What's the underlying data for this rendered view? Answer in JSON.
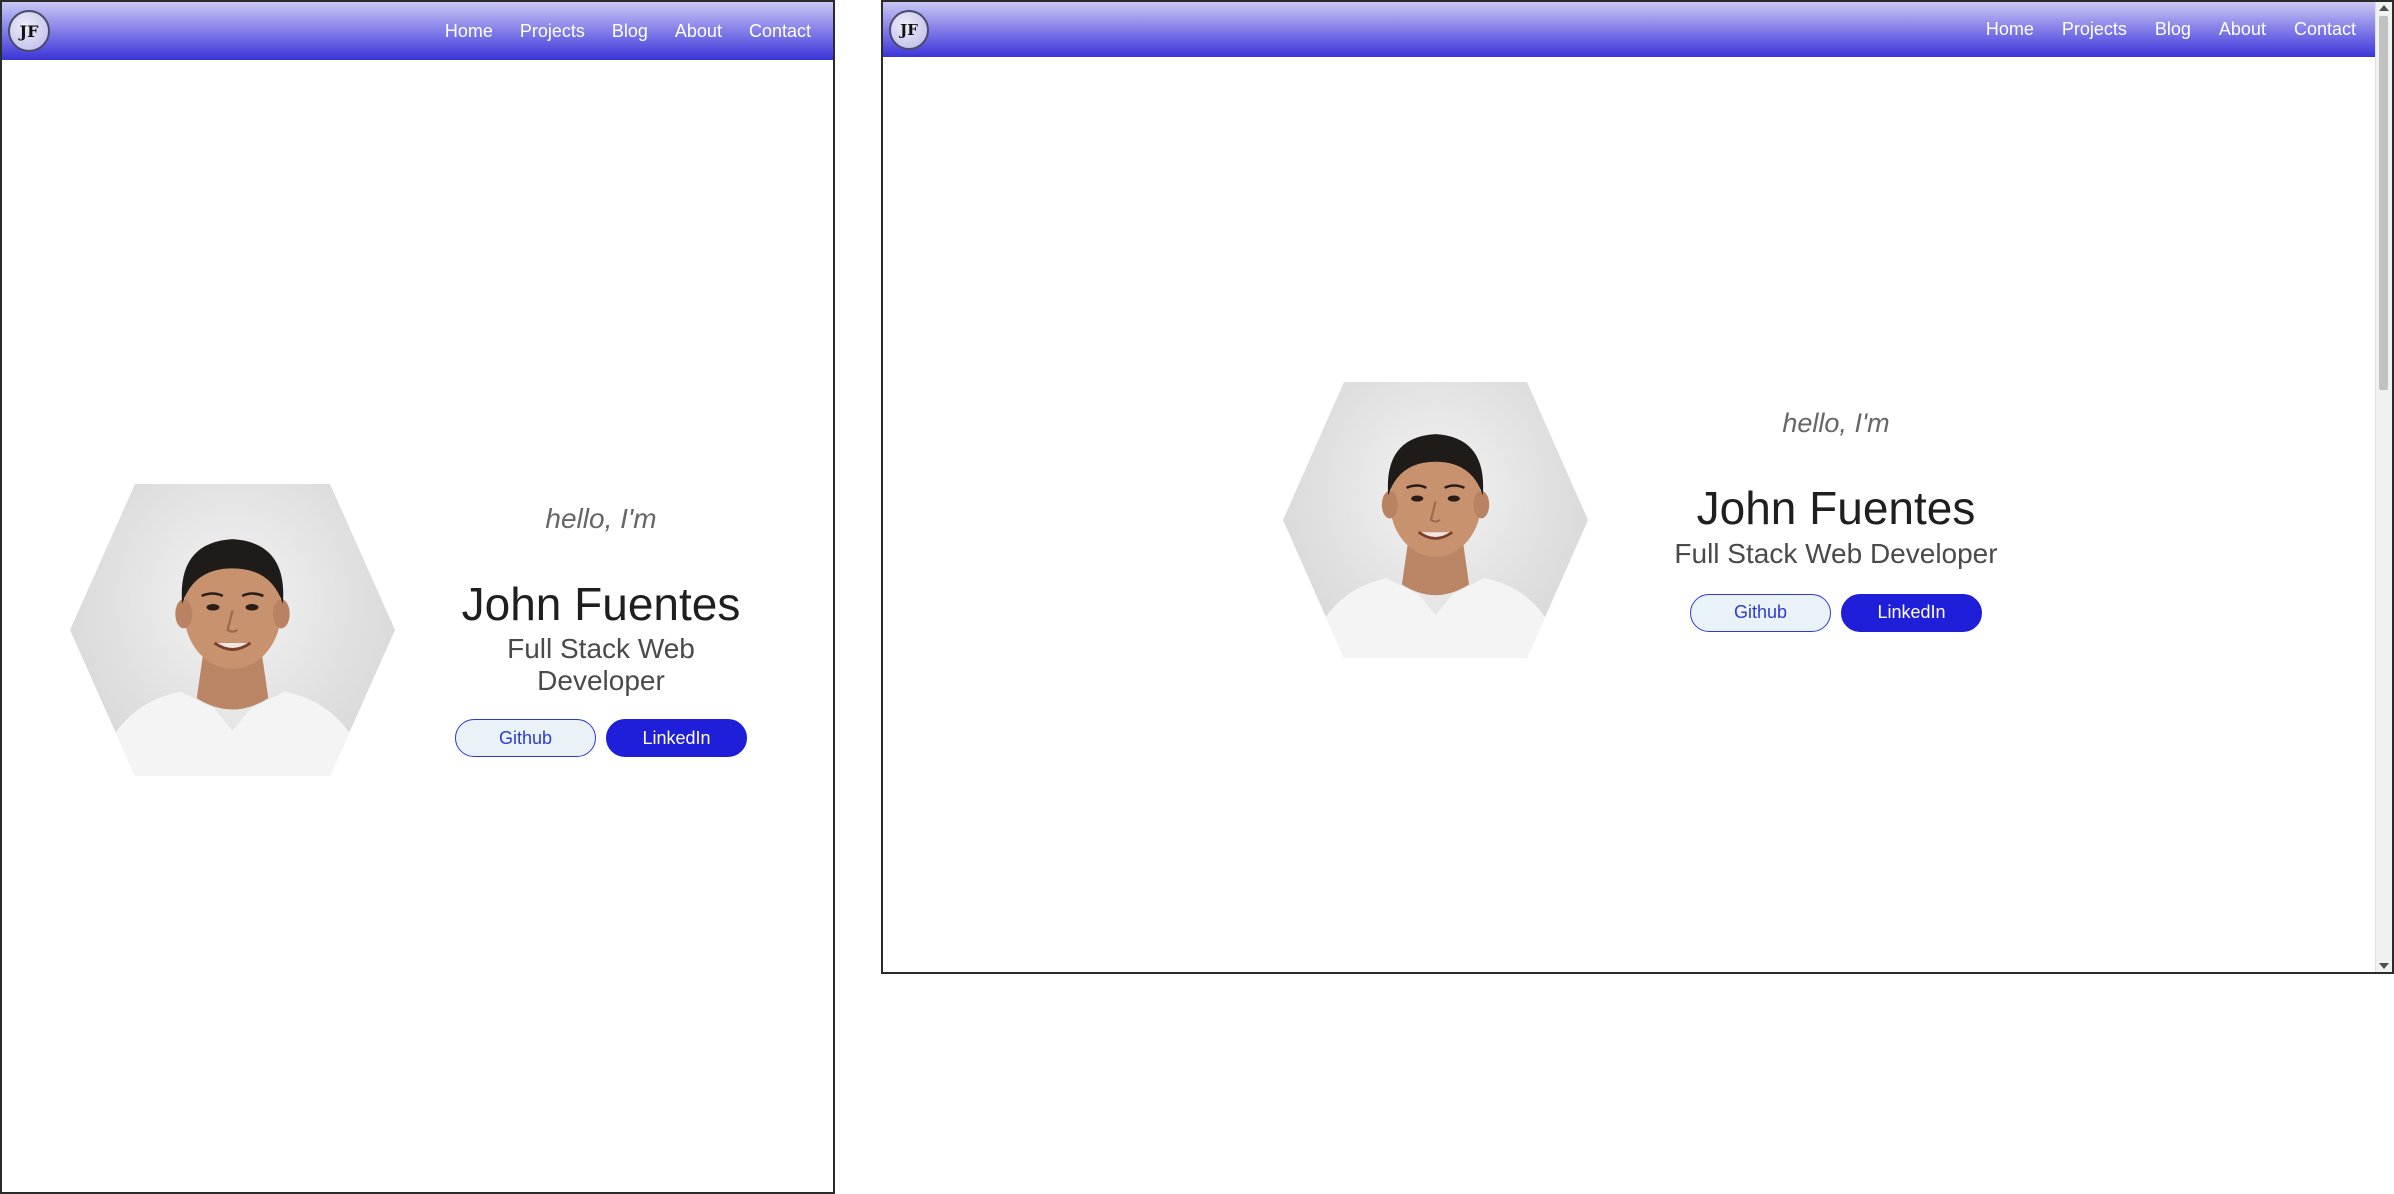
{
  "brand": {
    "logo_text": "JF"
  },
  "nav": {
    "items": [
      {
        "label": "Home"
      },
      {
        "label": "Projects"
      },
      {
        "label": "Blog"
      },
      {
        "label": "About"
      },
      {
        "label": "Contact"
      }
    ]
  },
  "hero": {
    "greeting": "hello, I'm",
    "name": "John Fuentes",
    "role": "Full Stack Web Developer",
    "github_label": "Github",
    "linkedin_label": "LinkedIn",
    "portrait_icon": "portrait-photo"
  },
  "colors": {
    "accent": "#1f1ed8",
    "nav_gradient_top": "#c9c8f4",
    "nav_gradient_bottom": "#3b34d8",
    "github_bg": "#e9f2f7"
  }
}
